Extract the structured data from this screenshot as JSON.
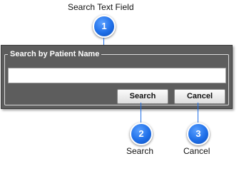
{
  "callouts": [
    {
      "number": "1",
      "label": "Search Text Field"
    },
    {
      "number": "2",
      "label": "Search"
    },
    {
      "number": "3",
      "label": "Cancel"
    }
  ],
  "panel": {
    "group_title": "Search by Patient Name",
    "search_input": {
      "value": "",
      "placeholder": ""
    },
    "search_button_label": "Search",
    "cancel_button_label": "Cancel"
  },
  "colors": {
    "marker": "#1f6fe8",
    "panel_background": "#5d5d5d"
  }
}
